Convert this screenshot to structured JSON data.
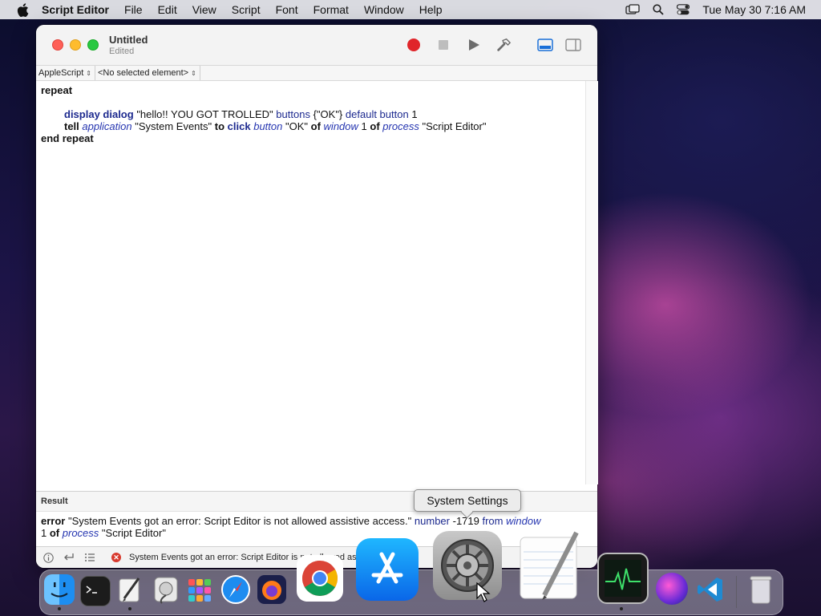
{
  "menubar": {
    "app_name": "Script Editor",
    "items": [
      "File",
      "Edit",
      "View",
      "Script",
      "Font",
      "Format",
      "Window",
      "Help"
    ],
    "clock": "Tue May 30  7:16 AM"
  },
  "window": {
    "title": "Untitled",
    "subtitle": "Edited",
    "language_popup": "AppleScript",
    "element_popup": "<No selected element>"
  },
  "script": {
    "line1": "repeat",
    "line2": {
      "cmd": "display dialog",
      "str": "\"hello!! YOU GOT TROLLED\"",
      "p1": "buttons",
      "list": "{\"OK\"}",
      "p2": "default button",
      "num": "1"
    },
    "line3": {
      "tell": "tell",
      "app": "application",
      "app_str": "\"System Events\"",
      "to": "to",
      "click": "click",
      "button": "button",
      "ok_str": "\"OK\"",
      "of1": "of",
      "window": "window",
      "num": "1",
      "of2": "of",
      "process": "process",
      "proc_str": "\"Script Editor\""
    },
    "line4": "end repeat"
  },
  "result": {
    "header": "Result",
    "error_kw": "error",
    "error_msg": "\"System Events got an error: Script Editor is not allowed assistive access.\"",
    "number_kw": "number",
    "number_val": "-1719",
    "from_kw": "from",
    "window_kw": "window",
    "num": "1",
    "of_kw": "of",
    "process_kw": "process",
    "process_str": "\"Script Editor\""
  },
  "statusbar": {
    "message": "System Events got an error: Script Editor is not allowed assistive access."
  },
  "tooltip": "System Settings",
  "dock": {
    "items": [
      "Finder",
      "Terminal",
      "Script Editor",
      "Disk Utility",
      "Launchpad",
      "Safari",
      "Firefox",
      "Google Chrome",
      "App Store",
      "System Settings",
      "TextEdit",
      "Activity Monitor",
      "Siri",
      "Visual Studio Code",
      "Trash"
    ]
  },
  "colors": {
    "keyword": "#111111",
    "command": "#1d2a8f",
    "class": "#2535b0",
    "record_red": "#e0252a",
    "error_red": "#d83a2e"
  }
}
